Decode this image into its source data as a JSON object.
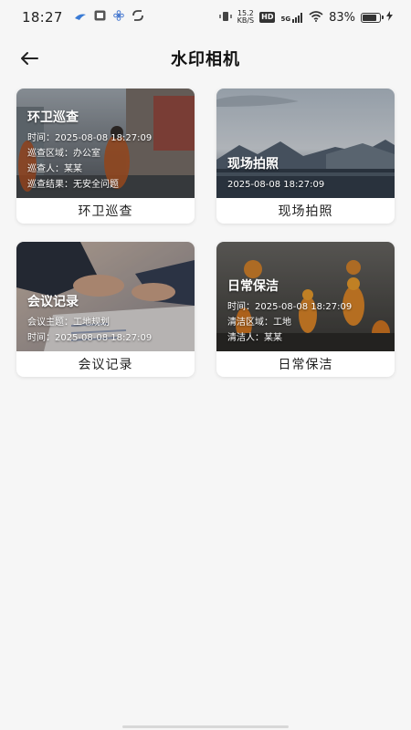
{
  "status_bar": {
    "time": "18:27",
    "net_speed_value": "15.2",
    "net_speed_unit": "KB/S",
    "hd_badge": "HD",
    "signal_label": "5G",
    "battery_percent": "83%",
    "battery_level": 0.83
  },
  "header": {
    "title": "水印相机"
  },
  "cards": [
    {
      "label": "环卫巡查",
      "overlay_title": "环卫巡查",
      "lines": [
        "时间：2025-08-08 18:27:09",
        "巡查区域：办公室",
        "巡查人：某某",
        "巡查结果：无安全问题"
      ]
    },
    {
      "label": "现场拍照",
      "overlay_title": "现场拍照",
      "lines": [
        "2025-08-08 18:27:09"
      ]
    },
    {
      "label": "会议记录",
      "overlay_title": "会议记录",
      "lines": [
        "会议主题：工地规划",
        "时间：2025-08-08 18:27:09"
      ]
    },
    {
      "label": "日常保洁",
      "overlay_title": "日常保洁",
      "lines": [
        "时间：2025-08-08 18:27:09",
        "清洁区域：工地",
        "清洁人：某某"
      ]
    }
  ]
}
